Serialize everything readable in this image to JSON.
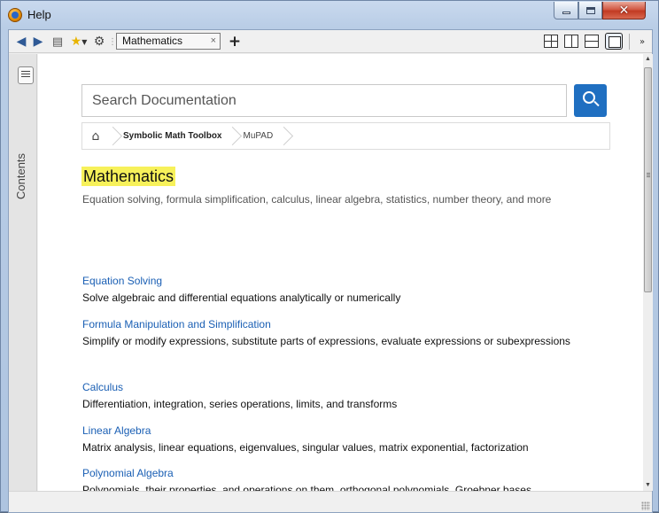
{
  "window": {
    "title": "Help"
  },
  "toolbar": {
    "back_icon": "back-arrow-icon",
    "forward_icon": "forward-arrow-icon",
    "print_icon": "print-icon",
    "favorites_icon": "star-icon",
    "settings_icon": "gear-icon",
    "tab_label": "Mathematics",
    "tab_close": "×",
    "new_tab": "+"
  },
  "sidebar": {
    "label": "Contents"
  },
  "search": {
    "placeholder": "Search Documentation"
  },
  "breadcrumb": [
    "Symbolic Math Toolbox",
    "MuPAD"
  ],
  "page": {
    "title": "Mathematics",
    "description": "Equation solving, formula simplification, calculus, linear algebra, statistics, number theory, and more"
  },
  "sections": [
    {
      "title": "Equation Solving",
      "description": "Solve algebraic and differential equations analytically or numerically"
    },
    {
      "title": "Formula Manipulation and Simplification",
      "description": "Simplify or modify expressions, substitute parts of expressions, evaluate expressions or subexpressions"
    },
    {
      "title": "Calculus",
      "description": "Differentiation, integration, series operations, limits, and transforms"
    },
    {
      "title": "Linear Algebra",
      "description": "Matrix analysis, linear equations, eigenvalues, singular values, matrix exponential, factorization"
    },
    {
      "title": "Polynomial Algebra",
      "description": "Polynomials, their properties, and operations on them, orthogonal polynomials, Groebner bases"
    }
  ],
  "colors": {
    "accent": "#1f6fc1",
    "link": "#1a5fb4",
    "highlight": "#f7f15a",
    "close": "#c23a22"
  }
}
